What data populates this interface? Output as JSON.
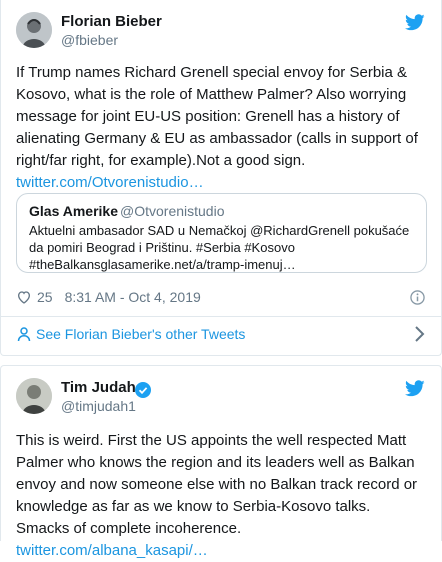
{
  "tweet1": {
    "name": "Florian Bieber",
    "handle": "@fbieber",
    "text": "If Trump names Richard Grenell special envoy for Serbia & Kosovo, what is the role of Matthew Palmer? Also worrying message for joint EU-US position: Grenell has a history of alienating Germany & EU as ambassador (calls in support of right/far right, for example).Not a good sign.",
    "link": "twitter.com/Otvorenistudio…",
    "quote": {
      "name": "Glas Amerike",
      "handle": "@Otvorenistudio",
      "text": "Aktuelni ambasador SAD u Nemačkoj @RichardGrenell  pokušaće da pomiri Beograd i Prištinu. #Serbia #Kosovo #theBalkansglasamerike.net/a/tramp-imenuj…"
    },
    "likes": "25",
    "timestamp": "8:31 AM - Oct 4, 2019",
    "see_more": "See Florian Bieber's other Tweets"
  },
  "tweet2": {
    "name": "Tim Judah",
    "handle": "@timjudah1",
    "text": "This is weird. First the US appoints the well respected Matt Palmer who knows the region and its leaders well as Balkan envoy and now someone else with no Balkan track record or knowledge as far as we know to Serbia-Kosovo talks. Smacks of complete incoherence. ",
    "link": "twitter.com/albana_kasapi/…"
  },
  "icons": {
    "brand": "twitter-bird-icon",
    "like": "heart-icon",
    "info": "info-icon",
    "verified": "verified-badge-icon",
    "see_more": "person-icon",
    "chevron": "chevron-right-icon"
  },
  "colors": {
    "link": "#1b95e0",
    "text": "#14171a",
    "secondary": "#657786",
    "border": "#e1e8ed"
  }
}
